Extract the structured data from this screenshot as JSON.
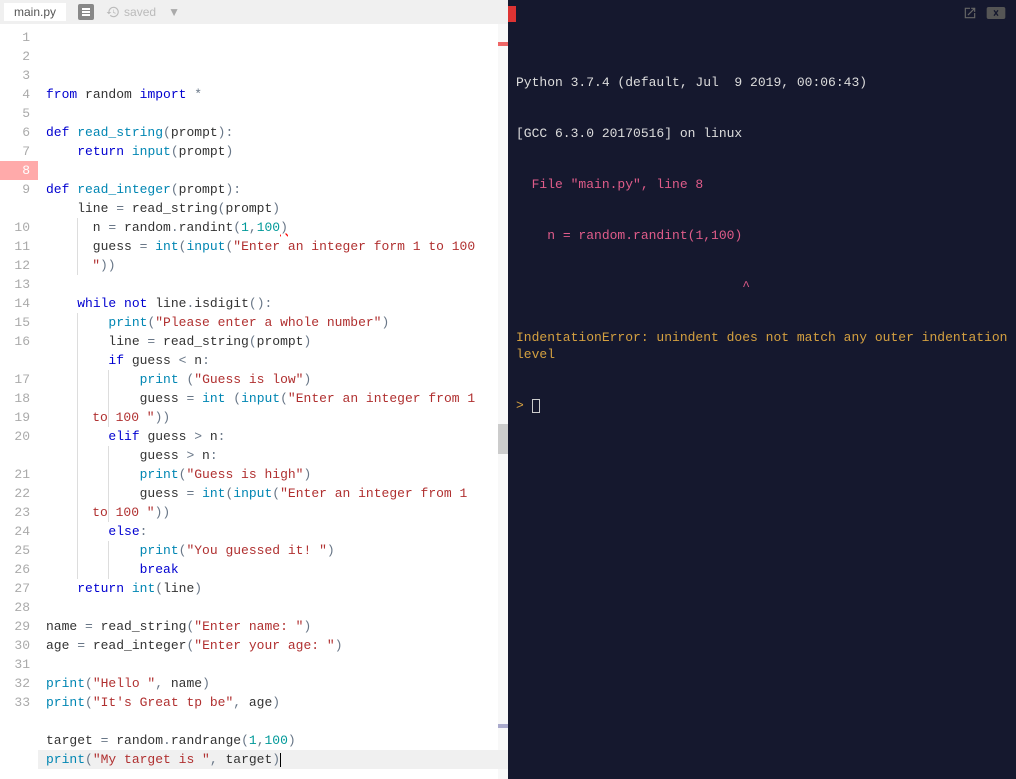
{
  "tab": {
    "filename": "main.py",
    "saved_label": "saved"
  },
  "editor": {
    "lines": [
      {
        "n": 1,
        "tokens": [
          [
            "kw",
            "from"
          ],
          [
            "nm",
            " random "
          ],
          [
            "kw",
            "import"
          ],
          [
            "nm",
            " "
          ],
          [
            "op",
            "*"
          ]
        ]
      },
      {
        "n": 2,
        "tokens": []
      },
      {
        "n": 3,
        "tokens": [
          [
            "kw",
            "def"
          ],
          [
            "nm",
            " "
          ],
          [
            "fn",
            "read_string"
          ],
          [
            "op",
            "("
          ],
          [
            "nm",
            "prompt"
          ],
          [
            "op",
            "):"
          ]
        ]
      },
      {
        "n": 4,
        "tokens": [
          [
            "nm",
            "    "
          ],
          [
            "kw",
            "return"
          ],
          [
            "nm",
            " "
          ],
          [
            "fn",
            "input"
          ],
          [
            "op",
            "("
          ],
          [
            "nm",
            "prompt"
          ],
          [
            "op",
            ")"
          ]
        ]
      },
      {
        "n": 5,
        "tokens": []
      },
      {
        "n": 6,
        "tokens": [
          [
            "kw",
            "def"
          ],
          [
            "nm",
            " "
          ],
          [
            "fn",
            "read_integer"
          ],
          [
            "op",
            "("
          ],
          [
            "nm",
            "prompt"
          ],
          [
            "op",
            "):"
          ]
        ]
      },
      {
        "n": 7,
        "tokens": [
          [
            "nm",
            "    line "
          ],
          [
            "op",
            "="
          ],
          [
            "nm",
            " read_string"
          ],
          [
            "op",
            "("
          ],
          [
            "nm",
            "prompt"
          ],
          [
            "op",
            ")"
          ]
        ]
      },
      {
        "n": 8,
        "err": true,
        "tokens": [
          [
            "nm",
            "      n "
          ],
          [
            "op",
            "="
          ],
          [
            "nm",
            " random"
          ],
          [
            "op",
            "."
          ],
          [
            "nm",
            "randint"
          ],
          [
            "op",
            "("
          ],
          [
            "nu",
            "1"
          ],
          [
            "op",
            ","
          ],
          [
            "nu",
            "100"
          ],
          [
            "op-er",
            ")"
          ]
        ]
      },
      {
        "n": 9,
        "tokens": [
          [
            "nm",
            "      guess "
          ],
          [
            "op",
            "="
          ],
          [
            "nm",
            " "
          ],
          [
            "fn",
            "int"
          ],
          [
            "op",
            "("
          ],
          [
            "fn",
            "input"
          ],
          [
            "op",
            "("
          ],
          [
            "st",
            "\"Enter an integer form 1 to 100 "
          ]
        ],
        "wrap": [
          [
            "st",
            "\""
          ],
          [
            "op",
            "))"
          ]
        ]
      },
      {
        "n": 10,
        "tokens": []
      },
      {
        "n": 11,
        "tokens": [
          [
            "nm",
            "    "
          ],
          [
            "kw",
            "while"
          ],
          [
            "nm",
            " "
          ],
          [
            "kw",
            "not"
          ],
          [
            "nm",
            " line"
          ],
          [
            "op",
            "."
          ],
          [
            "nm",
            "isdigit"
          ],
          [
            "op",
            "():"
          ]
        ]
      },
      {
        "n": 12,
        "tokens": [
          [
            "nm",
            "        "
          ],
          [
            "fn",
            "print"
          ],
          [
            "op",
            "("
          ],
          [
            "st",
            "\"Please enter a whole number\""
          ],
          [
            "op",
            ")"
          ]
        ]
      },
      {
        "n": 13,
        "tokens": [
          [
            "nm",
            "        line "
          ],
          [
            "op",
            "="
          ],
          [
            "nm",
            " read_string"
          ],
          [
            "op",
            "("
          ],
          [
            "nm",
            "prompt"
          ],
          [
            "op",
            ")"
          ]
        ]
      },
      {
        "n": 14,
        "tokens": [
          [
            "nm",
            "        "
          ],
          [
            "kw",
            "if"
          ],
          [
            "nm",
            " guess "
          ],
          [
            "op",
            "<"
          ],
          [
            "nm",
            " n"
          ],
          [
            "op",
            ":"
          ]
        ]
      },
      {
        "n": 15,
        "tokens": [
          [
            "nm",
            "            "
          ],
          [
            "fn",
            "print"
          ],
          [
            "nm",
            " "
          ],
          [
            "op",
            "("
          ],
          [
            "st",
            "\"Guess is low\""
          ],
          [
            "op",
            ")"
          ]
        ]
      },
      {
        "n": 16,
        "tokens": [
          [
            "nm",
            "            guess "
          ],
          [
            "op",
            "="
          ],
          [
            "nm",
            " "
          ],
          [
            "fn",
            "int"
          ],
          [
            "nm",
            " "
          ],
          [
            "op",
            "("
          ],
          [
            "fn",
            "input"
          ],
          [
            "op",
            "("
          ],
          [
            "st",
            "\"Enter an integer from 1 "
          ]
        ],
        "wrap": [
          [
            "st",
            "to 100 \""
          ],
          [
            "op",
            "))"
          ]
        ]
      },
      {
        "n": 17,
        "tokens": [
          [
            "nm",
            "        "
          ],
          [
            "kw",
            "elif"
          ],
          [
            "nm",
            " guess "
          ],
          [
            "op",
            ">"
          ],
          [
            "nm",
            " n"
          ],
          [
            "op",
            ":"
          ]
        ]
      },
      {
        "n": 18,
        "tokens": [
          [
            "nm",
            "            guess "
          ],
          [
            "op",
            ">"
          ],
          [
            "nm",
            " n"
          ],
          [
            "op",
            ":"
          ]
        ]
      },
      {
        "n": 19,
        "tokens": [
          [
            "nm",
            "            "
          ],
          [
            "fn",
            "print"
          ],
          [
            "op",
            "("
          ],
          [
            "st",
            "\"Guess is high\""
          ],
          [
            "op",
            ")"
          ]
        ]
      },
      {
        "n": 20,
        "tokens": [
          [
            "nm",
            "            guess "
          ],
          [
            "op",
            "="
          ],
          [
            "nm",
            " "
          ],
          [
            "fn",
            "int"
          ],
          [
            "op",
            "("
          ],
          [
            "fn",
            "input"
          ],
          [
            "op",
            "("
          ],
          [
            "st",
            "\"Enter an integer from 1 "
          ]
        ],
        "wrap": [
          [
            "st",
            "to 100 \""
          ],
          [
            "op",
            "))"
          ]
        ]
      },
      {
        "n": 21,
        "tokens": [
          [
            "nm",
            "        "
          ],
          [
            "kw",
            "else"
          ],
          [
            "op",
            ":"
          ]
        ]
      },
      {
        "n": 22,
        "tokens": [
          [
            "nm",
            "            "
          ],
          [
            "fn",
            "print"
          ],
          [
            "op",
            "("
          ],
          [
            "st",
            "\"You guessed it! \""
          ],
          [
            "op",
            ")"
          ]
        ]
      },
      {
        "n": 23,
        "tokens": [
          [
            "nm",
            "            "
          ],
          [
            "kw",
            "break"
          ]
        ]
      },
      {
        "n": 24,
        "tokens": [
          [
            "nm",
            "    "
          ],
          [
            "kw",
            "return"
          ],
          [
            "nm",
            " "
          ],
          [
            "fn",
            "int"
          ],
          [
            "op",
            "("
          ],
          [
            "nm",
            "line"
          ],
          [
            "op",
            ")"
          ]
        ]
      },
      {
        "n": 25,
        "tokens": []
      },
      {
        "n": 26,
        "tokens": [
          [
            "nm",
            "name "
          ],
          [
            "op",
            "="
          ],
          [
            "nm",
            " read_string"
          ],
          [
            "op",
            "("
          ],
          [
            "st",
            "\"Enter name: \""
          ],
          [
            "op",
            ")"
          ]
        ]
      },
      {
        "n": 27,
        "tokens": [
          [
            "nm",
            "age "
          ],
          [
            "op",
            "="
          ],
          [
            "nm",
            " read_integer"
          ],
          [
            "op",
            "("
          ],
          [
            "st",
            "\"Enter your age: \""
          ],
          [
            "op",
            ")"
          ]
        ]
      },
      {
        "n": 28,
        "tokens": []
      },
      {
        "n": 29,
        "tokens": [
          [
            "fn",
            "print"
          ],
          [
            "op",
            "("
          ],
          [
            "st",
            "\"Hello \""
          ],
          [
            "op",
            ","
          ],
          [
            "nm",
            " name"
          ],
          [
            "op",
            ")"
          ]
        ]
      },
      {
        "n": 30,
        "tokens": [
          [
            "fn",
            "print"
          ],
          [
            "op",
            "("
          ],
          [
            "st",
            "\"It's Great tp be\""
          ],
          [
            "op",
            ","
          ],
          [
            "nm",
            " age"
          ],
          [
            "op",
            ")"
          ]
        ]
      },
      {
        "n": 31,
        "tokens": []
      },
      {
        "n": 32,
        "tokens": [
          [
            "nm",
            "target "
          ],
          [
            "op",
            "="
          ],
          [
            "nm",
            " random"
          ],
          [
            "op",
            "."
          ],
          [
            "nm",
            "randrange"
          ],
          [
            "op",
            "("
          ],
          [
            "nu",
            "1"
          ],
          [
            "op",
            ","
          ],
          [
            "nu",
            "100"
          ],
          [
            "op",
            ")"
          ]
        ]
      },
      {
        "n": 33,
        "hl": true,
        "cursor": true,
        "tokens": [
          [
            "fn",
            "print"
          ],
          [
            "op",
            "("
          ],
          [
            "st",
            "\"My target is \""
          ],
          [
            "op",
            ","
          ],
          [
            "nm",
            " target"
          ],
          [
            "op",
            ")"
          ]
        ]
      }
    ]
  },
  "terminal": {
    "header1": "Python 3.7.4 (default, Jul  9 2019, 00:06:43)",
    "header2": "[GCC 6.3.0 20170516] on linux",
    "file_line": "  File \"main.py\", line 8",
    "code_line": "    n = random.randint(1,100)",
    "caret_line": "                             ^",
    "error_msg": "IndentationError: unindent does not match any outer indentation level",
    "prompt": "> "
  }
}
